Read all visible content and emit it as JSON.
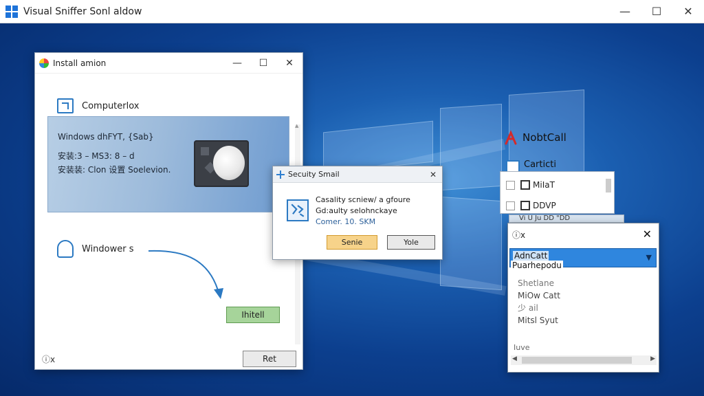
{
  "app": {
    "title": "Visual Sniffer Sonl aldow",
    "minimize": "—",
    "maximize": "☐",
    "close": "✕"
  },
  "installer": {
    "title": "Install amion",
    "minimize": "—",
    "maximize": "☐",
    "close": "✕",
    "computer_label": "Computerlox",
    "banner": {
      "line1": "Windows  dhFYT,  {Sab}",
      "line2": "安装:3 – MS3:  8  –  d",
      "line3": "安装装:  Clon 设置  Soelevion."
    },
    "windows_update_label": "Windower s",
    "install_button": "Ihitell",
    "ret_button": "Ret",
    "footer": "ⓘx"
  },
  "security": {
    "title": "Secuity Smail",
    "close": "✕",
    "line1": "Casality scniew/ a gfoure",
    "line2": "Gd:aulty selohnckaye",
    "line3": "Comer. 10. SKM",
    "service_button": "Senie",
    "yole_button": "Yole"
  },
  "right": {
    "notify_label": "NobtCall",
    "cert_label": "Carticti",
    "list": [
      {
        "label": "MiIaT"
      },
      {
        "label": "DDVP"
      }
    ],
    "strip_text": "Vi  U    Ju  DD  \"DD",
    "dropdown": {
      "header": "ⓘx",
      "close": "✕",
      "selected": "AdnCatt",
      "sub": "Puarhepodu",
      "options": [
        "Shetlane",
        "MiOw Catt",
        "少 ail",
        "Mitsl Syut"
      ],
      "footer": "Iuve"
    }
  },
  "colors": {
    "accent": "#2f86de",
    "install_green": "#a6d49a",
    "service_orange": "#f7d38a"
  }
}
